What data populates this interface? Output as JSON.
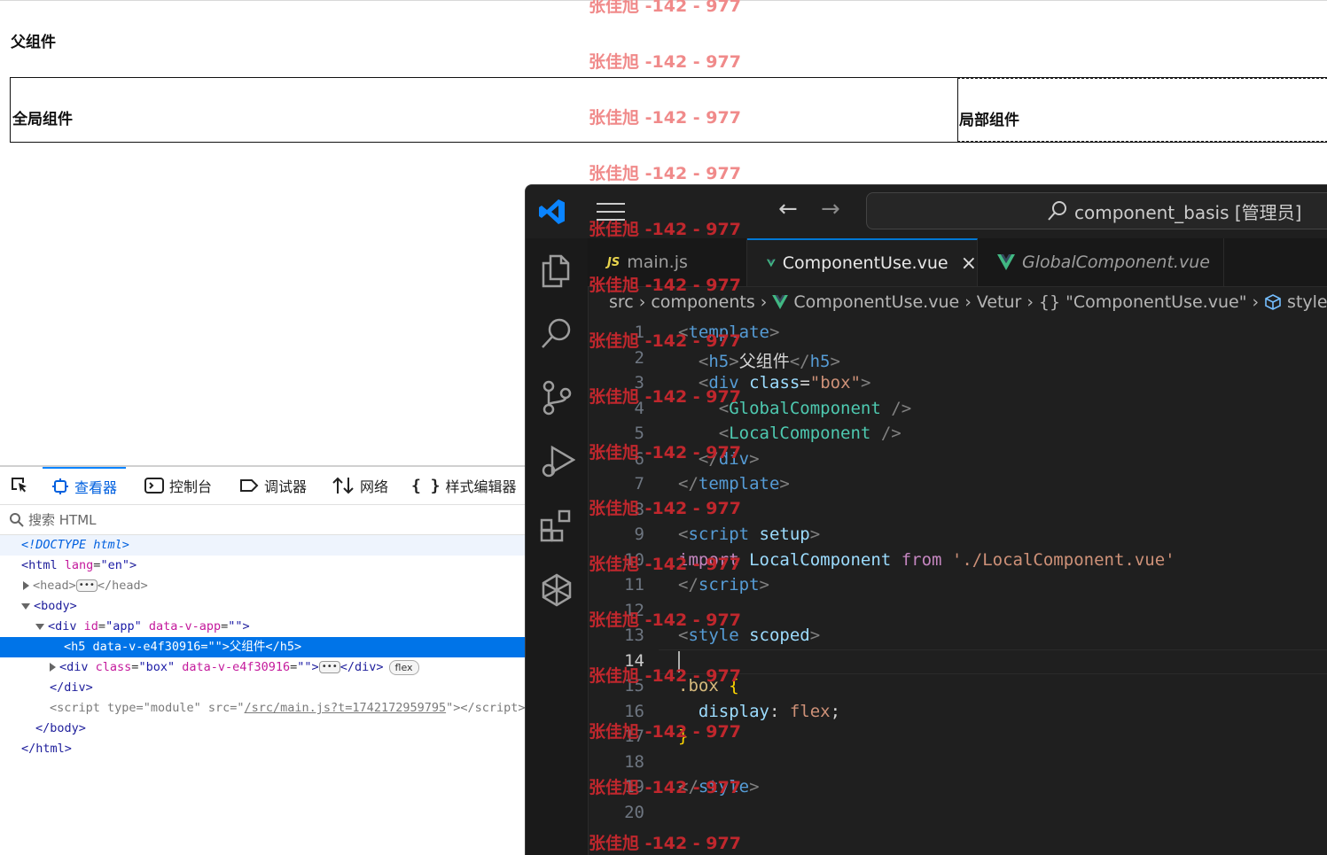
{
  "page": {
    "parent_title": "父组件",
    "global_label": "全局组件",
    "local_label": "局部组件"
  },
  "devtools": {
    "tabs": [
      "查看器",
      "控制台",
      "调试器",
      "网络",
      "样式编辑器"
    ],
    "search_placeholder": "搜索 HTML",
    "tree": {
      "doctype": "<!DOCTYPE html>",
      "html_open": "<html",
      "lang_attr": "lang",
      "lang_val": "\"en\"",
      "head": "head",
      "body": "body",
      "div_app_attrs": {
        "id": "\"app\"",
        "data": "\"\""
      },
      "h5_line": "<h5 data-v-e4f30916=\"\">父组件</h5>",
      "div_box": {
        "cls": "\"box\"",
        "data": "\"\""
      },
      "flex_badge": "flex",
      "script_type": "\"module\"",
      "script_src": "/src/main.js?t=1742172959795",
      "close_div": "</div>",
      "close_body": "</body>",
      "close_html": "</html>"
    }
  },
  "vscode": {
    "title": "component_basis [管理员]",
    "tabs": [
      {
        "label": "main.js",
        "badge": "JS"
      },
      {
        "label": "ComponentUse.vue",
        "close": "×"
      },
      {
        "label": "GlobalComponent.vue"
      }
    ],
    "breadcrumb": [
      "src",
      "components",
      "ComponentUse.vue",
      "Vetur",
      "{} \"ComponentUse.vue\"",
      "style"
    ],
    "line_numbers": [
      "1",
      "2",
      "3",
      "4",
      "5",
      "6",
      "7",
      "8",
      "9",
      "10",
      "11",
      "12",
      "13",
      "14",
      "15",
      "16",
      "17",
      "18",
      "19",
      "20"
    ],
    "current_line": "14",
    "code": {
      "l1": "template",
      "l2_text": "父组件",
      "l3_class": "\"box\"",
      "l4": "GlobalComponent",
      "l5": "LocalComponent",
      "l9_attr": "setup",
      "l10_ident": "LocalComponent",
      "l10_path": "'./LocalComponent.vue'",
      "l13_attr": "scoped",
      "l15_sel": ".box",
      "l16_prop": "display",
      "l16_val": "flex"
    }
  },
  "watermark": {
    "text": "张佳旭 -142 - 977",
    "light_color": "#f08a8a",
    "dark_color": "#c0272d"
  },
  "colors": {
    "accent": "#0a84ff",
    "vscode_bg": "#1f1f1f",
    "vue_green": "#41b883"
  }
}
